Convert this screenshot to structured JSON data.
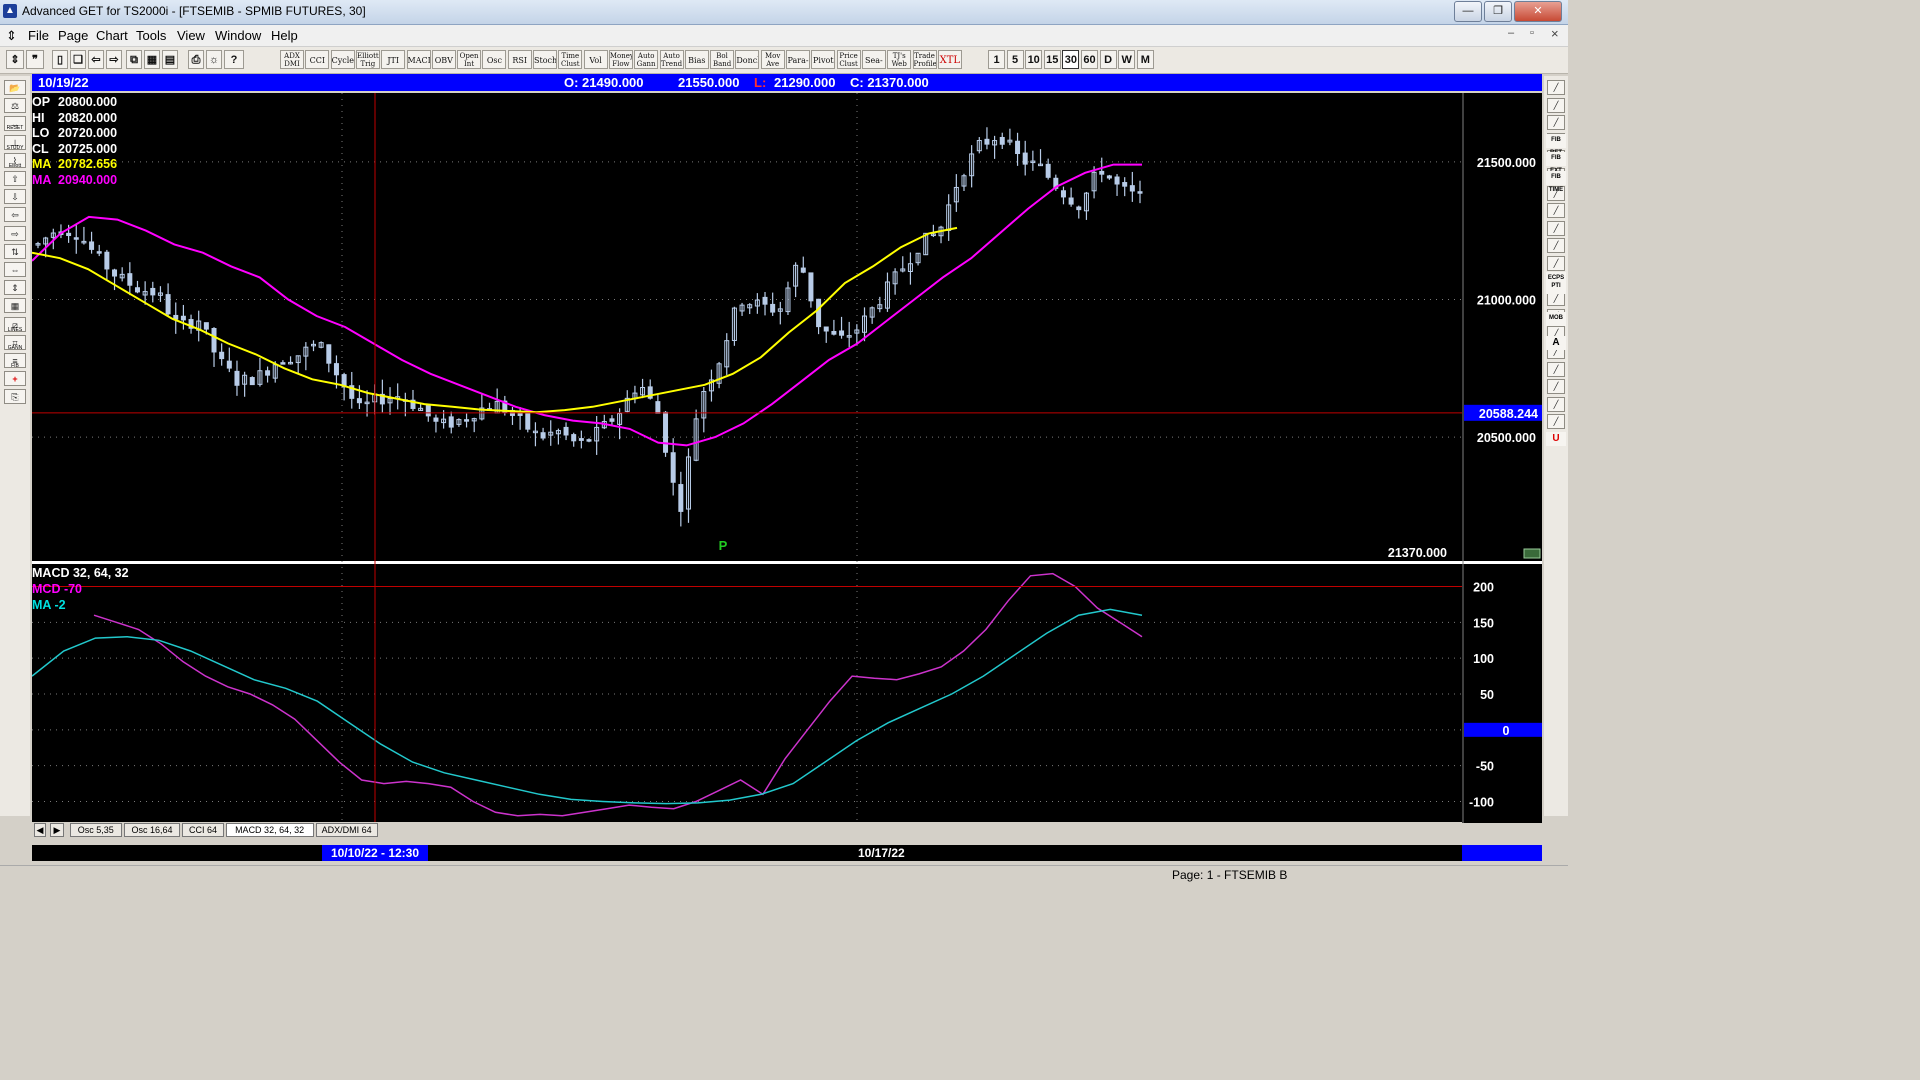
{
  "window": {
    "title": "Advanced GET for TS2000i - [FTSEMIB - SPMIB FUTURES, 30]",
    "controls": {
      "minimize": "—",
      "restore": "❐",
      "close": "✕"
    },
    "mdi_controls": {
      "minimize": "–",
      "restore": "▫",
      "close": "×"
    }
  },
  "menu": [
    "File",
    "Page",
    "Chart",
    "Tools",
    "View",
    "Window",
    "Help"
  ],
  "toolbar": {
    "studies": [
      "ADX DMI",
      "CCI",
      "Cycles",
      "Elliott Trig",
      "JTI",
      "MACD",
      "OBV",
      "Open Int",
      "Osc",
      "RSI",
      "Stoch",
      "Time Clust",
      "Vol",
      "Money Flow",
      "Auto Gann",
      "Auto Trend",
      "Bias",
      "Bol Band",
      "Donch",
      "Mov Ave",
      "Para-bolic",
      "Pivot",
      "Price Clust",
      "Sea-sonals",
      "TJ's Web",
      "Trade Profile",
      "XTL"
    ],
    "intervals": [
      "1",
      "5",
      "10",
      "15",
      "30",
      "60",
      "D",
      "W",
      "M"
    ],
    "active_interval": "30"
  },
  "left_tools": [
    "RESET",
    "STUDY",
    "Elliott",
    "LINES",
    "GANN",
    "FIB"
  ],
  "right_tools": [
    "FIB RET",
    "FIB EXT",
    "FIB TIME",
    "ECPS",
    "PTI",
    "MOB",
    "A",
    "U"
  ],
  "header": {
    "date": "10/19/22",
    "open": "O: 21490.000",
    "high": "21550.000",
    "low_label": "L:",
    "low": "21290.000",
    "close": "C: 21370.000"
  },
  "readouts": [
    {
      "label": "OP",
      "value": "20800.000",
      "color": "#ffffff"
    },
    {
      "label": "HI",
      "value": "20820.000",
      "color": "#ffffff"
    },
    {
      "label": "LO",
      "value": "20720.000",
      "color": "#ffffff"
    },
    {
      "label": "CL",
      "value": "20725.000",
      "color": "#ffffff"
    },
    {
      "label": "MA",
      "value": "20782.656",
      "color": "#ffff00"
    },
    {
      "label": "MA",
      "value": "20940.000",
      "color": "#ff00ff"
    }
  ],
  "cursor_price": "20588.244",
  "last_price": "21370.000",
  "pivot_marker": "P",
  "macd_readouts": [
    {
      "text": "MACD 32, 64, 32",
      "color": "#ffffff"
    },
    {
      "text": "MCD -70",
      "color": "#ff00ff"
    },
    {
      "text": "MA   -2",
      "color": "#00e0e0"
    }
  ],
  "zero_label": "0",
  "tabs": [
    "Osc 5,35",
    "Osc 16,64",
    "CCI 64",
    "MACD 32, 64, 32",
    "ADX/DMI 64"
  ],
  "date_labels": [
    "10/10/22 - 12:30",
    "10/17/22"
  ],
  "status": "Page: 1 - FTSEMIB B",
  "colors": {
    "candle": "#b8cce8",
    "ma_fast": "#ffff00",
    "ma_slow": "#ff00ff",
    "macd": "#cc33cc",
    "signal": "#22c8cc",
    "crosshair": "#c00000",
    "header": "#0000ff"
  },
  "chart_data": [
    {
      "type": "candlestick",
      "title": "FTSEMIB - SPMIB FUTURES, 30",
      "ylim": [
        20050,
        21750
      ],
      "y_ticks": [
        21500,
        21000,
        20500
      ],
      "y_tick_labels": [
        "21500.000",
        "21000.000",
        "20500.000"
      ],
      "bars": 145,
      "price_path": [
        21200,
        21260,
        21240,
        21150,
        21080,
        21040,
        21020,
        20900,
        20930,
        20780,
        20700,
        20720,
        20780,
        20800,
        20840,
        20720,
        20600,
        20640,
        20650,
        20610,
        20540,
        20560,
        20600,
        20620,
        20560,
        20500,
        20520,
        20470,
        20520,
        20590,
        20700,
        20580,
        20220,
        20640,
        20780,
        21000,
        20980,
        20960,
        21150,
        20900,
        20850,
        20900,
        21000,
        21100,
        21200,
        21250,
        21450,
        21560,
        21600,
        21510,
        21480,
        21400,
        21340,
        21480,
        21400,
        21370
      ],
      "ma_fast_path": [
        21170,
        21150,
        21110,
        21050,
        20990,
        20930,
        20890,
        20840,
        20800,
        20750,
        20710,
        20690,
        20660,
        20640,
        20620,
        20610,
        20600,
        20595,
        20590,
        20598,
        20610,
        20630,
        20650,
        20670,
        20690,
        20730,
        20790,
        20880,
        20960,
        21060,
        21120,
        21190,
        21240,
        21260
      ],
      "ma_slow_path": [
        21140,
        21240,
        21300,
        21290,
        21250,
        21200,
        21170,
        21120,
        21080,
        21000,
        20940,
        20900,
        20840,
        20780,
        20730,
        20690,
        20650,
        20610,
        20580,
        20560,
        20550,
        20530,
        20480,
        20470,
        20500,
        20550,
        20620,
        20700,
        20780,
        20840,
        20920,
        21000,
        21080,
        21150,
        21240,
        21330,
        21410,
        21460,
        21490,
        21490
      ],
      "pivot_label": "P"
    },
    {
      "type": "line",
      "title": "MACD 32, 64, 32",
      "ylim": [
        -130,
        230
      ],
      "y_ticks": [
        200,
        150,
        100,
        50,
        0,
        -50,
        -100
      ],
      "series": [
        {
          "name": "MCD",
          "values": [
            160,
            150,
            140,
            120,
            95,
            75,
            60,
            50,
            35,
            15,
            -15,
            -45,
            -70,
            -75,
            -72,
            -75,
            -80,
            -100,
            -115,
            -120,
            -118,
            -120,
            -115,
            -110,
            -105,
            -108,
            -110,
            -100,
            -85,
            -70,
            -90,
            -40,
            0,
            40,
            75,
            72,
            70,
            78,
            88,
            110,
            140,
            180,
            215,
            218,
            200,
            170,
            150,
            130
          ]
        },
        {
          "name": "MA",
          "values": [
            75,
            110,
            128,
            130,
            125,
            110,
            90,
            70,
            58,
            40,
            10,
            -20,
            -45,
            -60,
            -70,
            -80,
            -90,
            -97,
            -100,
            -102,
            -103,
            -102,
            -98,
            -90,
            -75,
            -45,
            -15,
            10,
            30,
            50,
            75,
            105,
            135,
            160,
            168,
            160
          ]
        }
      ]
    }
  ]
}
